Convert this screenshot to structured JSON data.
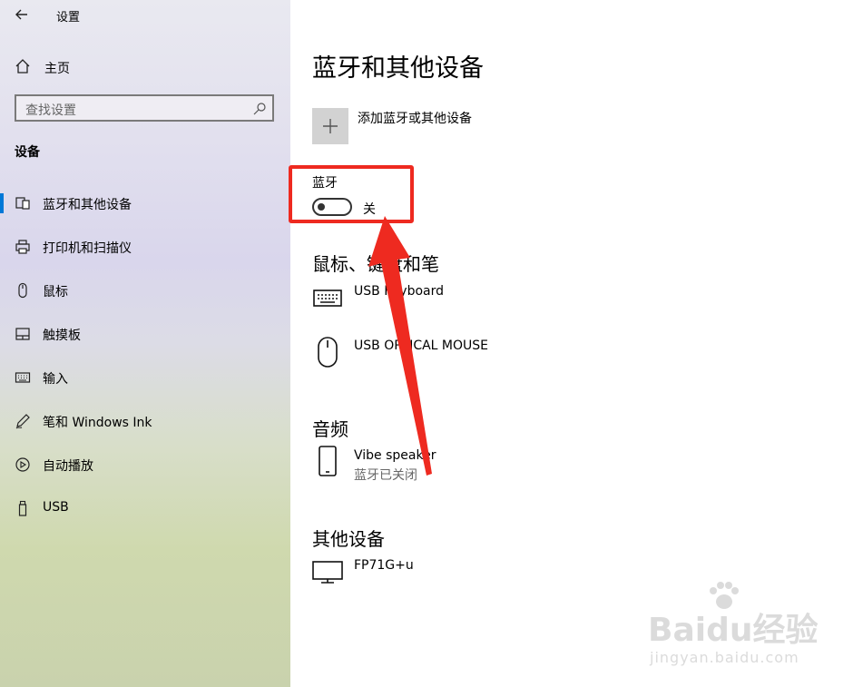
{
  "window": {
    "title": "设置",
    "back_icon": "arrow-left-icon"
  },
  "sidebar": {
    "home_label": "主页",
    "search_placeholder": "查找设置",
    "section_title": "设备",
    "items": [
      {
        "label": "蓝牙和其他设备",
        "icon": "bluetooth-devices-icon",
        "selected": true
      },
      {
        "label": "打印机和扫描仪",
        "icon": "printer-icon",
        "selected": false
      },
      {
        "label": "鼠标",
        "icon": "mouse-icon",
        "selected": false
      },
      {
        "label": "触摸板",
        "icon": "touchpad-icon",
        "selected": false
      },
      {
        "label": "输入",
        "icon": "keyboard-icon",
        "selected": false
      },
      {
        "label": "笔和 Windows Ink",
        "icon": "pen-icon",
        "selected": false
      },
      {
        "label": "自动播放",
        "icon": "autoplay-icon",
        "selected": false
      },
      {
        "label": "USB",
        "icon": "usb-icon",
        "selected": false
      }
    ]
  },
  "main": {
    "title": "蓝牙和其他设备",
    "add_device_label": "添加蓝牙或其他设备",
    "bluetooth": {
      "label": "蓝牙",
      "state_label": "关",
      "on": false
    },
    "groups": [
      {
        "title": "鼠标、键盘和笔",
        "devices": [
          {
            "name": "USB Keyboard",
            "icon": "keyboard-icon",
            "status": ""
          },
          {
            "name": "USB OPTICAL MOUSE",
            "icon": "mouse-icon",
            "status": ""
          }
        ]
      },
      {
        "title": "音频",
        "devices": [
          {
            "name": "Vibe speaker",
            "icon": "phone-icon",
            "status": "蓝牙已关闭"
          }
        ]
      },
      {
        "title": "其他设备",
        "devices": [
          {
            "name": "FP71G+u",
            "icon": "monitor-icon",
            "status": ""
          }
        ]
      }
    ]
  },
  "annotation": {
    "highlight_color": "#ee2a20",
    "arrow_color": "#ee2a20"
  },
  "watermark": {
    "main": "Baidu经验",
    "sub": "jingyan.baidu.com"
  },
  "colors": {
    "accent": "#0078d7"
  }
}
